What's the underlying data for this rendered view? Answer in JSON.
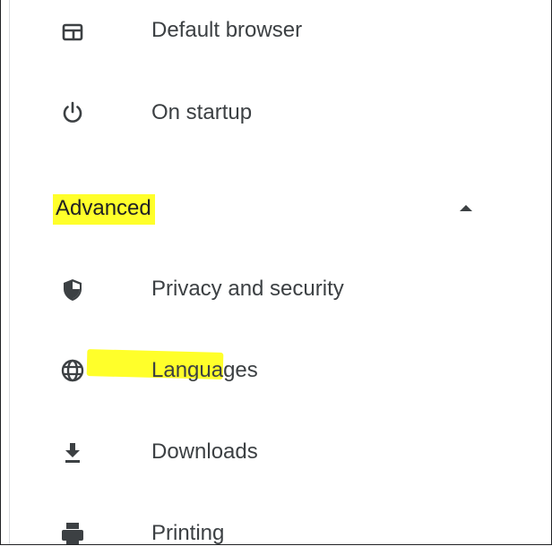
{
  "settings_menu": {
    "items_top": [
      {
        "label": "Default browser",
        "icon": "browser-window-icon"
      },
      {
        "label": "On startup",
        "icon": "power-icon"
      }
    ],
    "advanced_section": {
      "title": "Advanced",
      "expanded": true,
      "toggle_icon": "arrow-up-icon"
    },
    "items_advanced": [
      {
        "label": "Privacy and security",
        "icon": "shield-icon"
      },
      {
        "label": "Languages",
        "icon": "globe-icon"
      },
      {
        "label": "Downloads",
        "icon": "download-icon"
      },
      {
        "label": "Printing",
        "icon": "printer-icon"
      }
    ]
  },
  "colors": {
    "highlight": "#ffff2a",
    "text": "#3c4043",
    "icon": "#3c4043"
  }
}
